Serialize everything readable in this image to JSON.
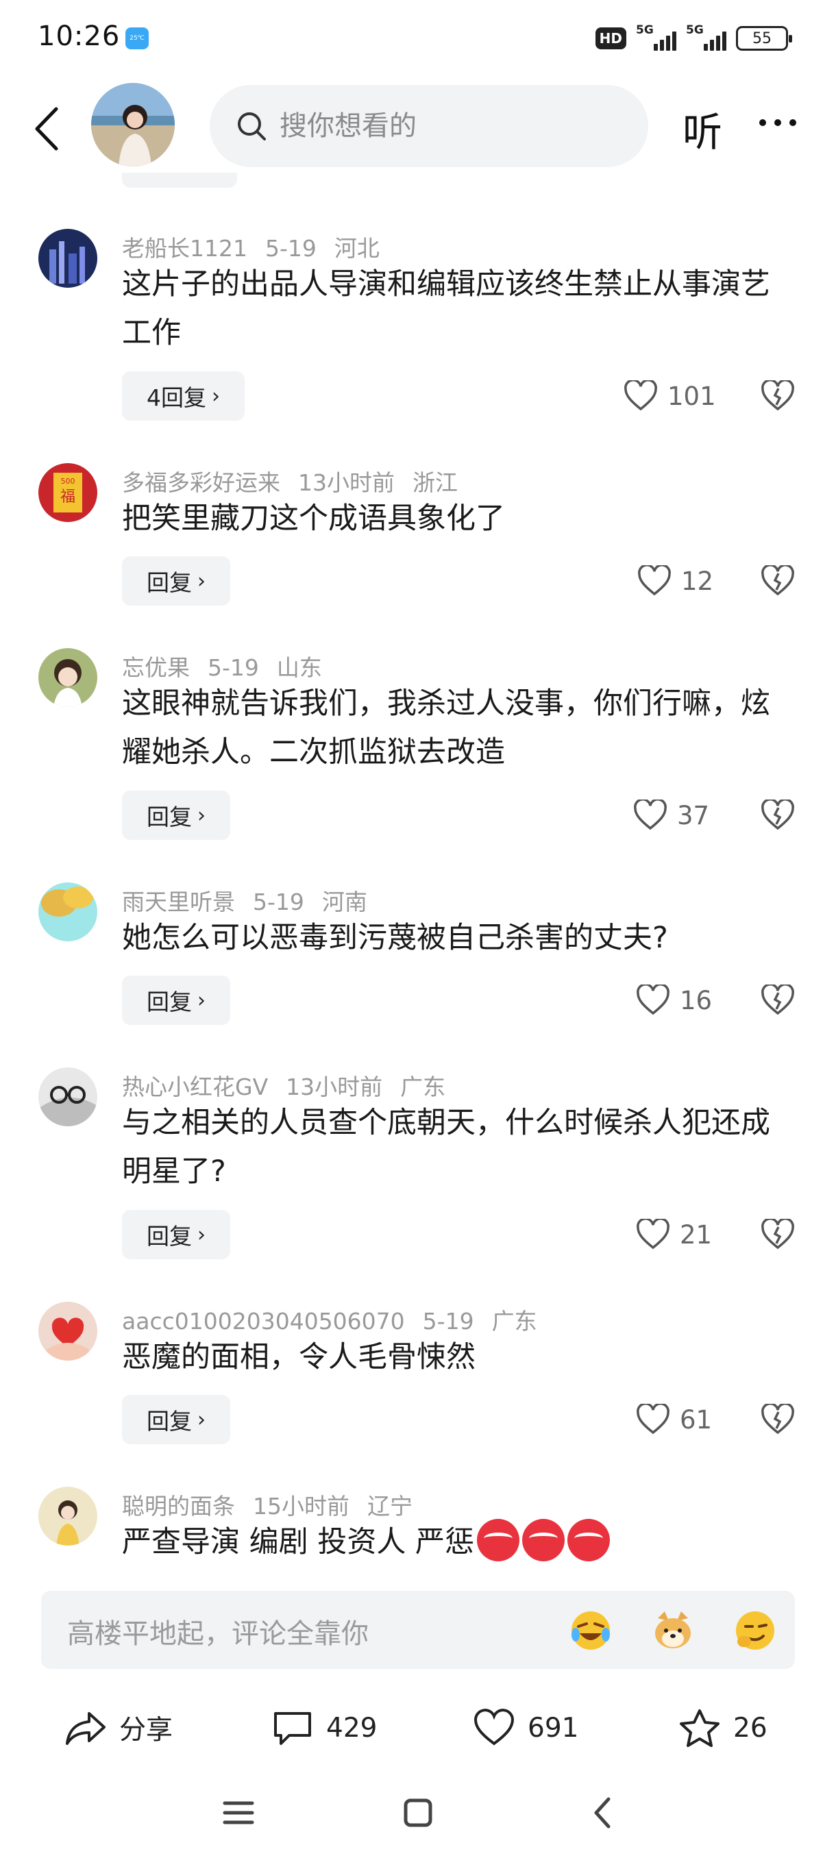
{
  "status_bar": {
    "time": "10:26",
    "weather_badge": "25℃",
    "hd_label": "HD",
    "network_1": "5G",
    "network_2": "5G",
    "battery": "55"
  },
  "header": {
    "back_icon": "back-arrow-icon",
    "search_placeholder": "搜你想看的",
    "listen_label": "听",
    "more_icon": "more-dots-icon"
  },
  "comments": [
    {
      "user": "老船长1121",
      "time": "5-19",
      "location": "河北",
      "text": "这片子的出品人导演和编辑应该终生禁止从事演艺工作",
      "reply_label": "4回复",
      "likes": "101",
      "avatar_color": "#1d2a5c"
    },
    {
      "user": "多福多彩好运来",
      "time": "13小时前",
      "location": "浙江",
      "text": "把笑里藏刀这个成语具象化了",
      "reply_label": "回复",
      "likes": "12",
      "avatar_color": "#c8262b"
    },
    {
      "user": "忘优果",
      "time": "5-19",
      "location": "山东",
      "text": "这眼神就告诉我们，我杀过人没事，你们行嘛，炫耀她杀人。二次抓监狱去改造",
      "reply_label": "回复",
      "likes": "37",
      "avatar_color": "#a8b87a"
    },
    {
      "user": "雨天里听景",
      "time": "5-19",
      "location": "河南",
      "text": "她怎么可以恶毒到污蔑被自己杀害的丈夫?",
      "reply_label": "回复",
      "likes": "16",
      "avatar_color": "#e6b84a"
    },
    {
      "user": "热心小红花GV",
      "time": "13小时前",
      "location": "广东",
      "text": "与之相关的人员查个底朝天，什么时候杀人犯还成明星了?",
      "reply_label": "回复",
      "likes": "21",
      "avatar_color": "#cfcfcf"
    },
    {
      "user": "aacc0100203040506070",
      "time": "5-19",
      "location": "广东",
      "text": "恶魔的面相，令人毛骨悚然",
      "reply_label": "回复",
      "likes": "61",
      "avatar_color": "#f0d9cf"
    },
    {
      "user": "聪明的面条",
      "time": "15小时前",
      "location": "辽宁",
      "text": "严查导演 编剧 投资人 严惩",
      "avatar_color": "#efe6c8"
    }
  ],
  "comment_bar": {
    "placeholder": "高楼平地起，评论全靠你",
    "emojis": [
      "laughing-crying-emoji",
      "doge-emoji",
      "smirk-emoji"
    ]
  },
  "actions": {
    "share_label": "分享",
    "comments_count": "429",
    "likes_count": "691",
    "favorites_count": "26"
  },
  "nav": {
    "menu_icon": "menu-icon",
    "home_icon": "home-square-icon",
    "back_icon": "nav-back-icon"
  }
}
